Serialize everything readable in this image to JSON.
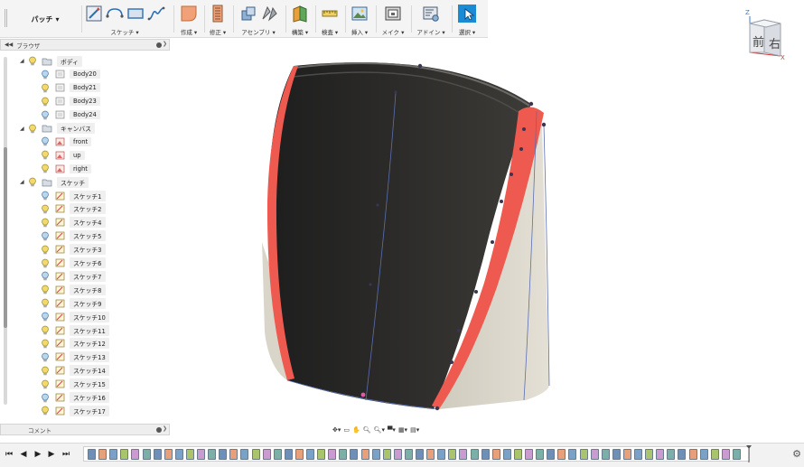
{
  "toolbar": {
    "workspace": "パッチ",
    "groups": [
      {
        "label": "スケッチ ▾",
        "icons": [
          "sketch-create-icon",
          "sketch-arc-icon",
          "sketch-rect-icon",
          "sketch-spline-icon"
        ]
      },
      {
        "label": "作成 ▾",
        "icons": [
          "create-patch-icon"
        ]
      },
      {
        "label": "修正 ▾",
        "icons": [
          "modify-icon"
        ]
      },
      {
        "label": "アセンブリ ▾",
        "icons": [
          "assembly-new-icon",
          "assembly-joint-icon"
        ]
      },
      {
        "label": "構築 ▾",
        "icons": [
          "construct-plane-icon"
        ]
      },
      {
        "label": "検査 ▾",
        "icons": [
          "inspect-measure-icon"
        ]
      },
      {
        "label": "挿入 ▾",
        "icons": [
          "insert-image-icon"
        ]
      },
      {
        "label": "メイク ▾",
        "icons": [
          "make-3dprint-icon"
        ]
      },
      {
        "label": "アドイン ▾",
        "icons": [
          "addin-script-icon"
        ]
      },
      {
        "label": "選択 ▾",
        "icons": [
          "select-cursor-icon"
        ]
      }
    ]
  },
  "browser": {
    "title": "ブラウザ",
    "folders": [
      {
        "name": "ボディ",
        "items": [
          "Body20",
          "Body21",
          "Body23",
          "Body24"
        ]
      },
      {
        "name": "キャンバス",
        "items": [
          "front",
          "up",
          "right"
        ]
      },
      {
        "name": "スケッチ",
        "items": [
          "スケッチ1",
          "スケッチ2",
          "スケッチ4",
          "スケッチ5",
          "スケッチ3",
          "スケッチ6",
          "スケッチ7",
          "スケッチ8",
          "スケッチ9",
          "スケッチ10",
          "スケッチ11",
          "スケッチ12",
          "スケッチ13",
          "スケッチ14",
          "スケッチ15",
          "スケッチ16",
          "スケッチ17"
        ]
      }
    ]
  },
  "comments": {
    "title": "コメント"
  },
  "viewcube": {
    "front": "前",
    "right": "右",
    "axis_z": "Z",
    "axis_x": "X"
  },
  "timeline": {
    "step_count": 60
  },
  "colors": {
    "accent": "#1a8ad4",
    "edge": "#ee5a4f",
    "body": "#2a2a2a",
    "surface": "#e3dfd3"
  }
}
